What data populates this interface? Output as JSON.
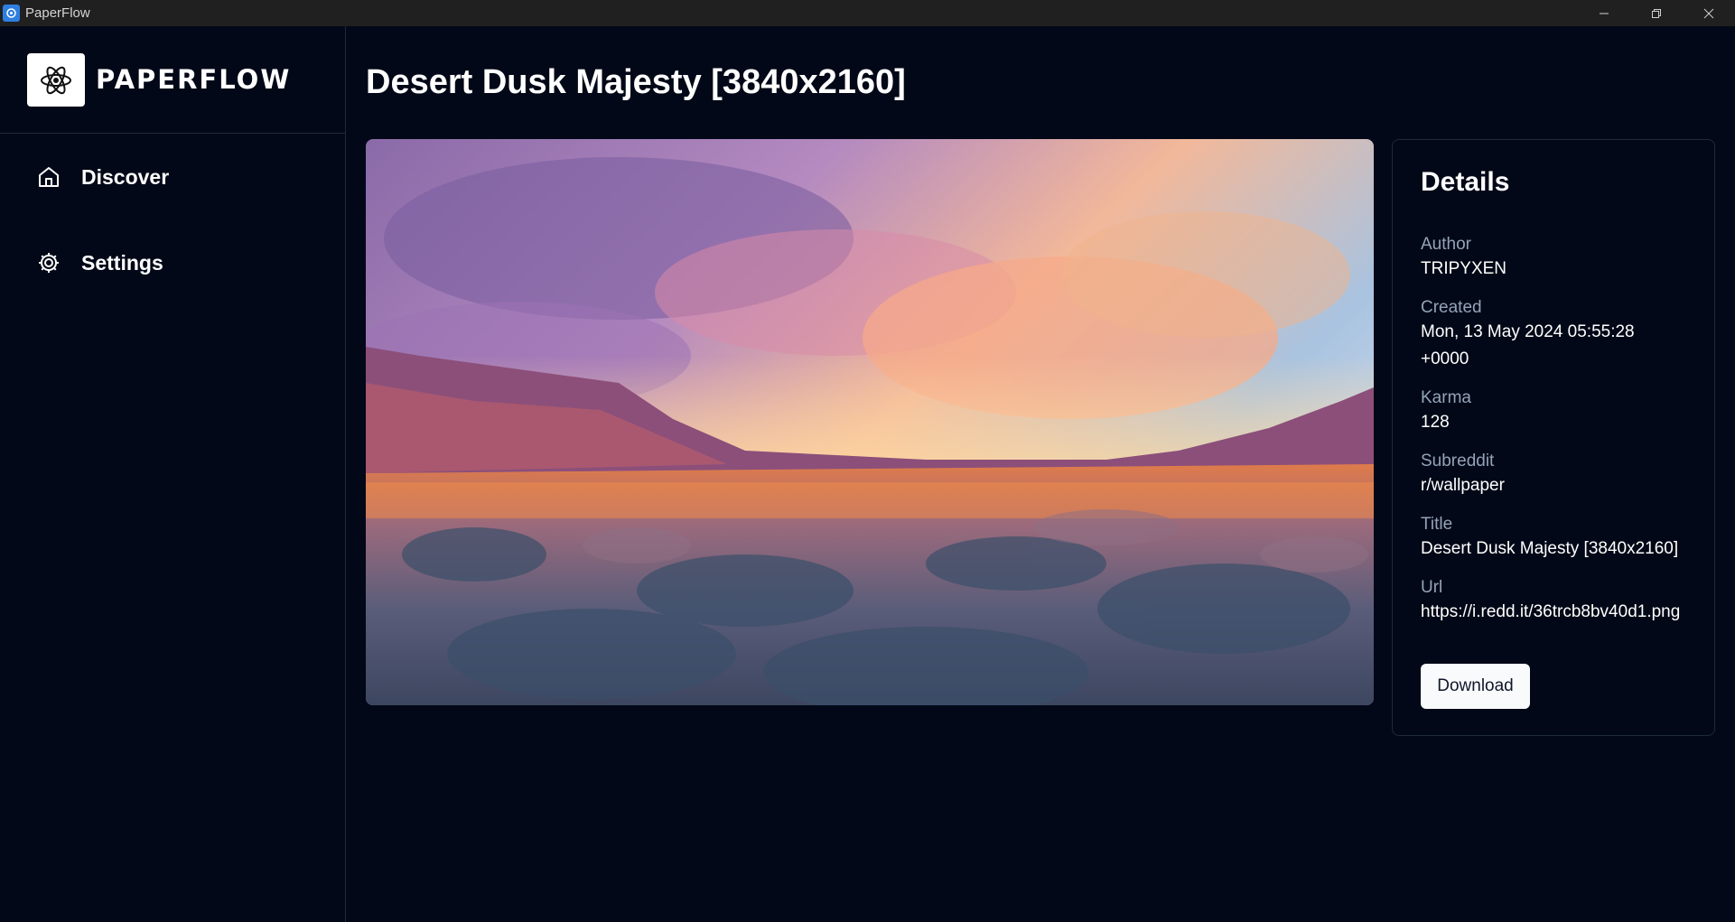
{
  "window": {
    "title": "PaperFlow"
  },
  "brand": {
    "name": "PAPERFLOW"
  },
  "sidebar": {
    "items": [
      {
        "label": "Discover",
        "icon": "home-icon"
      },
      {
        "label": "Settings",
        "icon": "gear-icon"
      }
    ]
  },
  "main": {
    "title": "Desert Dusk Majesty [3840x2160]"
  },
  "details": {
    "heading": "Details",
    "fields": [
      {
        "label": "Author",
        "value": "TRIPYXEN"
      },
      {
        "label": "Created",
        "value_line1": "Mon, 13 May 2024 05:55:28",
        "value_line2": "+0000"
      },
      {
        "label": "Karma",
        "value": "128"
      },
      {
        "label": "Subreddit",
        "value": "r/wallpaper"
      },
      {
        "label": "Title",
        "value": "Desert Dusk Majesty [3840x2160]"
      },
      {
        "label": "Url",
        "value": "https://i.redd.it/36trcb8bv40d1.png"
      }
    ],
    "download_label": "Download"
  },
  "colors": {
    "background": "#020817",
    "titlebar": "#202020",
    "border": "#1e293b",
    "muted_text": "#94a3b8",
    "button_bg": "#f8fafc"
  }
}
